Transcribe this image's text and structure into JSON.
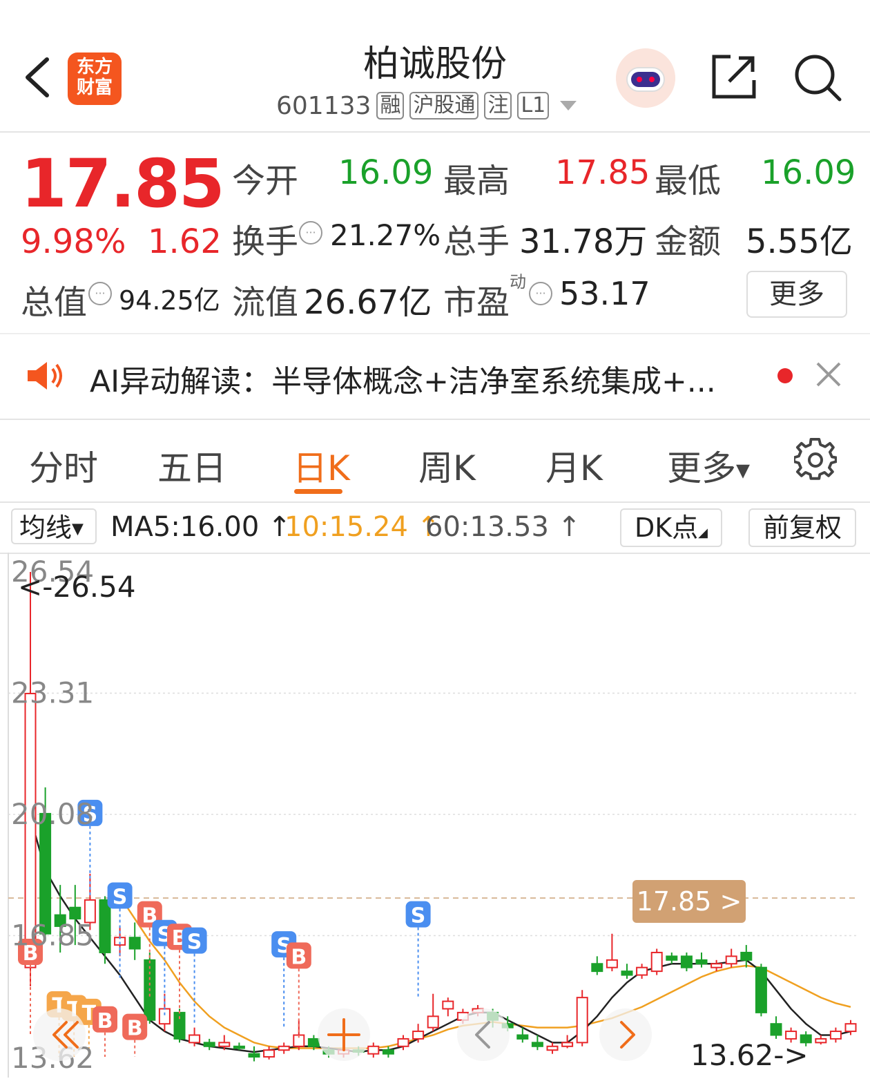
{
  "header": {
    "back_icon": "chevron-left-icon",
    "logo_text_line1": "东方",
    "logo_text_line2": "财富",
    "stock_name": "柏诚股份",
    "stock_code": "601133",
    "tags": [
      "融",
      "沪股通",
      "注",
      "L1"
    ]
  },
  "quote": {
    "price": "17.85",
    "change_pct": "9.98%",
    "change": "1.62",
    "open_label": "今开",
    "open": "16.09",
    "high_label": "最高",
    "high": "17.85",
    "low_label": "最低",
    "low": "16.09",
    "turnover_label": "换手",
    "turnover": "21.27%",
    "volume_label": "总手",
    "volume": "31.78万",
    "amount_label": "金额",
    "amount": "5.55亿",
    "mktcap_label": "总值",
    "mktcap": "94.25亿",
    "float_label": "流值",
    "float_cap": "26.67亿",
    "pe_label": "市盈",
    "pe_sup": "动",
    "pe": "53.17",
    "more_label": "更多",
    "colors": {
      "up": "#e8262a",
      "down": "#1aa12a"
    }
  },
  "banner": {
    "text": "AI异动解读：半导体概念+洁净室系统集成+...",
    "icon": "speaker-icon"
  },
  "tabs": {
    "items": [
      "分时",
      "五日",
      "日K",
      "周K",
      "月K",
      "更多"
    ],
    "active": "日K",
    "accent": "#f06d1a"
  },
  "ma": {
    "selector_label": "均线",
    "ma5": "MA5:16.00",
    "ma10": "10:15.24",
    "ma60": "60:13.53",
    "arrow": "↑",
    "dk_label": "DK点",
    "adjust_label": "前复权"
  },
  "chart_data": {
    "type": "candlestick",
    "y_ticks": [
      "26.54",
      "23.31",
      "20.08",
      "16.85",
      "13.62"
    ],
    "ylim": [
      13.62,
      26.54
    ],
    "max_annotation": "<-26.54",
    "min_annotation": "13.62->",
    "last_price_label": "17.85 >",
    "last_price": 17.85,
    "candles": [
      {
        "o": 16.0,
        "c": 23.3,
        "h": 26.54,
        "l": 15.5
      },
      {
        "o": 20.1,
        "c": 16.9,
        "h": 20.8,
        "l": 16.7
      },
      {
        "o": 17.4,
        "c": 17.1,
        "h": 18.2,
        "l": 16.4
      },
      {
        "o": 17.6,
        "c": 17.3,
        "h": 18.2,
        "l": 16.6
      },
      {
        "o": 17.2,
        "c": 17.8,
        "h": 18.5,
        "l": 17.0
      },
      {
        "o": 17.8,
        "c": 16.4,
        "h": 17.9,
        "l": 16.1
      },
      {
        "o": 16.6,
        "c": 16.8,
        "h": 17.1,
        "l": 16.3
      },
      {
        "o": 16.8,
        "c": 16.5,
        "h": 17.2,
        "l": 16.2
      },
      {
        "o": 16.2,
        "c": 14.6,
        "h": 16.4,
        "l": 14.5
      },
      {
        "o": 14.5,
        "c": 14.9,
        "h": 15.3,
        "l": 14.3
      },
      {
        "o": 14.8,
        "c": 14.1,
        "h": 14.9,
        "l": 14.0
      },
      {
        "o": 14.0,
        "c": 14.2,
        "h": 14.4,
        "l": 13.9
      },
      {
        "o": 14.0,
        "c": 13.9,
        "h": 14.1,
        "l": 13.8
      },
      {
        "o": 13.9,
        "c": 14.0,
        "h": 14.2,
        "l": 13.8
      },
      {
        "o": 13.9,
        "c": 13.85,
        "h": 14.0,
        "l": 13.8
      },
      {
        "o": 13.7,
        "c": 13.62,
        "h": 13.9,
        "l": 13.5
      },
      {
        "o": 13.62,
        "c": 13.8,
        "h": 13.9,
        "l": 13.55
      },
      {
        "o": 13.8,
        "c": 13.9,
        "h": 14.0,
        "l": 13.7
      },
      {
        "o": 13.9,
        "c": 14.2,
        "h": 14.6,
        "l": 13.8
      },
      {
        "o": 14.1,
        "c": 13.9,
        "h": 14.2,
        "l": 13.8
      },
      {
        "o": 13.8,
        "c": 13.7,
        "h": 13.9,
        "l": 13.6
      },
      {
        "o": 13.7,
        "c": 13.8,
        "h": 13.9,
        "l": 13.6
      },
      {
        "o": 13.8,
        "c": 13.75,
        "h": 13.9,
        "l": 13.65
      },
      {
        "o": 13.7,
        "c": 13.9,
        "h": 14.0,
        "l": 13.6
      },
      {
        "o": 13.8,
        "c": 13.7,
        "h": 13.9,
        "l": 13.6
      },
      {
        "o": 13.9,
        "c": 14.1,
        "h": 14.2,
        "l": 13.8
      },
      {
        "o": 14.1,
        "c": 14.3,
        "h": 14.5,
        "l": 14.0
      },
      {
        "o": 14.4,
        "c": 14.7,
        "h": 15.3,
        "l": 14.3
      },
      {
        "o": 14.9,
        "c": 15.1,
        "h": 15.2,
        "l": 14.7
      },
      {
        "o": 14.6,
        "c": 14.8,
        "h": 14.9,
        "l": 14.5
      },
      {
        "o": 14.8,
        "c": 14.9,
        "h": 15.0,
        "l": 14.7
      },
      {
        "o": 14.8,
        "c": 14.6,
        "h": 14.9,
        "l": 14.4
      },
      {
        "o": 14.5,
        "c": 14.4,
        "h": 14.7,
        "l": 14.3
      },
      {
        "o": 14.2,
        "c": 14.1,
        "h": 14.4,
        "l": 14.0
      },
      {
        "o": 14.0,
        "c": 13.9,
        "h": 14.2,
        "l": 13.8
      },
      {
        "o": 13.8,
        "c": 13.9,
        "h": 14.0,
        "l": 13.7
      },
      {
        "o": 13.9,
        "c": 14.0,
        "h": 14.2,
        "l": 13.85
      },
      {
        "o": 14.0,
        "c": 15.2,
        "h": 15.4,
        "l": 13.9
      },
      {
        "o": 16.1,
        "c": 15.9,
        "h": 16.3,
        "l": 15.8
      },
      {
        "o": 16.0,
        "c": 16.2,
        "h": 16.9,
        "l": 15.9
      },
      {
        "o": 15.9,
        "c": 15.8,
        "h": 16.1,
        "l": 15.7
      },
      {
        "o": 15.8,
        "c": 16.0,
        "h": 16.1,
        "l": 15.7
      },
      {
        "o": 15.9,
        "c": 16.4,
        "h": 16.5,
        "l": 15.8
      },
      {
        "o": 16.3,
        "c": 16.2,
        "h": 16.4,
        "l": 16.1
      },
      {
        "o": 16.3,
        "c": 16.0,
        "h": 16.4,
        "l": 15.9
      },
      {
        "o": 16.2,
        "c": 16.1,
        "h": 16.4,
        "l": 16.0
      },
      {
        "o": 16.0,
        "c": 16.1,
        "h": 16.2,
        "l": 15.9
      },
      {
        "o": 16.1,
        "c": 16.3,
        "h": 16.5,
        "l": 16.0
      },
      {
        "o": 16.4,
        "c": 16.2,
        "h": 16.6,
        "l": 16.0
      },
      {
        "o": 16.0,
        "c": 14.8,
        "h": 16.1,
        "l": 14.7
      },
      {
        "o": 14.5,
        "c": 14.2,
        "h": 14.7,
        "l": 14.1
      },
      {
        "o": 14.1,
        "c": 14.3,
        "h": 14.4,
        "l": 14.0
      },
      {
        "o": 14.2,
        "c": 14.0,
        "h": 14.3,
        "l": 13.9
      },
      {
        "o": 14.0,
        "c": 14.1,
        "h": 14.2,
        "l": 13.95
      },
      {
        "o": 14.1,
        "c": 14.3,
        "h": 14.4,
        "l": 14.0
      },
      {
        "o": 14.3,
        "c": 14.5,
        "h": 14.6,
        "l": 14.2
      }
    ],
    "ma5": [
      20.0,
      18.6,
      17.9,
      17.3,
      16.8,
      16.3,
      15.8,
      15.2,
      14.6,
      14.3,
      14.1,
      14.0,
      13.9,
      13.85,
      13.8,
      13.75,
      13.8,
      13.85,
      13.9,
      13.9,
      13.85,
      13.8,
      13.75,
      13.8,
      13.8,
      13.9,
      14.1,
      14.3,
      14.5,
      14.7,
      14.8,
      14.8,
      14.6,
      14.4,
      14.2,
      14.0,
      14.0,
      14.3,
      14.7,
      15.2,
      15.6,
      15.9,
      16.0,
      16.1,
      16.1,
      16.1,
      16.1,
      16.15,
      16.2,
      15.9,
      15.4,
      14.9,
      14.5,
      14.2,
      14.2,
      14.3
    ],
    "ma10": [
      null,
      null,
      null,
      null,
      null,
      null,
      17.9,
      17.3,
      16.7,
      16.2,
      15.6,
      15.1,
      14.7,
      14.4,
      14.2,
      14.0,
      13.9,
      13.85,
      13.85,
      13.85,
      13.85,
      13.85,
      13.85,
      13.85,
      13.9,
      14.0,
      14.1,
      14.2,
      14.35,
      14.45,
      14.5,
      14.55,
      14.5,
      14.45,
      14.4,
      14.4,
      14.4,
      14.45,
      14.55,
      14.65,
      14.8,
      14.95,
      15.15,
      15.35,
      15.55,
      15.75,
      15.9,
      16.0,
      16.05,
      16.0,
      15.8,
      15.6,
      15.4,
      15.2,
      15.05,
      14.95
    ]
  },
  "chart_markers": [
    {
      "label": "S",
      "color": "blue",
      "i": 4,
      "p": 20.1
    },
    {
      "label": "S",
      "color": "blue",
      "i": 6,
      "p": 17.9
    },
    {
      "label": "B",
      "color": "red",
      "i": 8,
      "p": 17.4
    },
    {
      "label": "S",
      "color": "blue",
      "i": 9,
      "p": 16.9
    },
    {
      "label": "B",
      "color": "red",
      "i": 10,
      "p": 16.8
    },
    {
      "label": "S",
      "color": "blue",
      "i": 11,
      "p": 16.7
    },
    {
      "label": "B",
      "color": "red",
      "i": 0,
      "p": 16.4
    },
    {
      "label": "T",
      "color": "orange",
      "i": 1,
      "p": 15.0
    },
    {
      "label": "T",
      "color": "orange",
      "i": 2,
      "p": 14.9
    },
    {
      "label": "T",
      "color": "orange",
      "i": 3,
      "p": 14.8
    },
    {
      "label": "B",
      "color": "red",
      "i": 5,
      "p": 14.6
    },
    {
      "label": "B",
      "color": "red",
      "i": 7,
      "p": 14.4
    },
    {
      "label": "S",
      "color": "blue",
      "i": 17,
      "p": 16.6
    },
    {
      "label": "B",
      "color": "red",
      "i": 18,
      "p": 16.3
    },
    {
      "label": "S",
      "color": "blue",
      "i": 26,
      "p": 17.4
    }
  ]
}
